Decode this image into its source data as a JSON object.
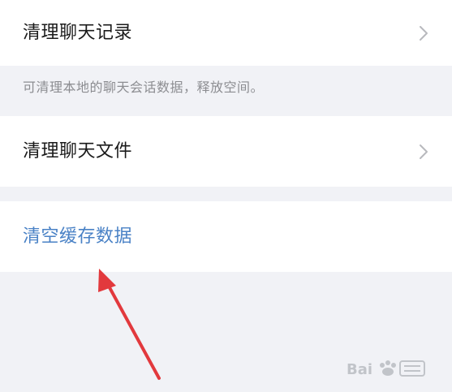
{
  "settings": {
    "items": [
      {
        "label": "清理聊天记录",
        "has_chevron": true
      },
      {
        "label": "清理聊天文件",
        "has_chevron": true
      },
      {
        "label": "清空缓存数据",
        "has_chevron": false
      }
    ],
    "records_hint": "可清理本地的聊天会话数据，释放空间。"
  },
  "colors": {
    "background": "#f1f2f6",
    "row_background": "#ffffff",
    "primary_text": "#1a1a1a",
    "hint_text": "#8c8d91",
    "link_text": "#4a82c6",
    "chevron": "#b8b9bd",
    "annotation_arrow": "#e2393d"
  },
  "icons": {
    "chevron": "chevron-right-icon",
    "watermark": "baidu-jingyan-watermark-icon"
  }
}
